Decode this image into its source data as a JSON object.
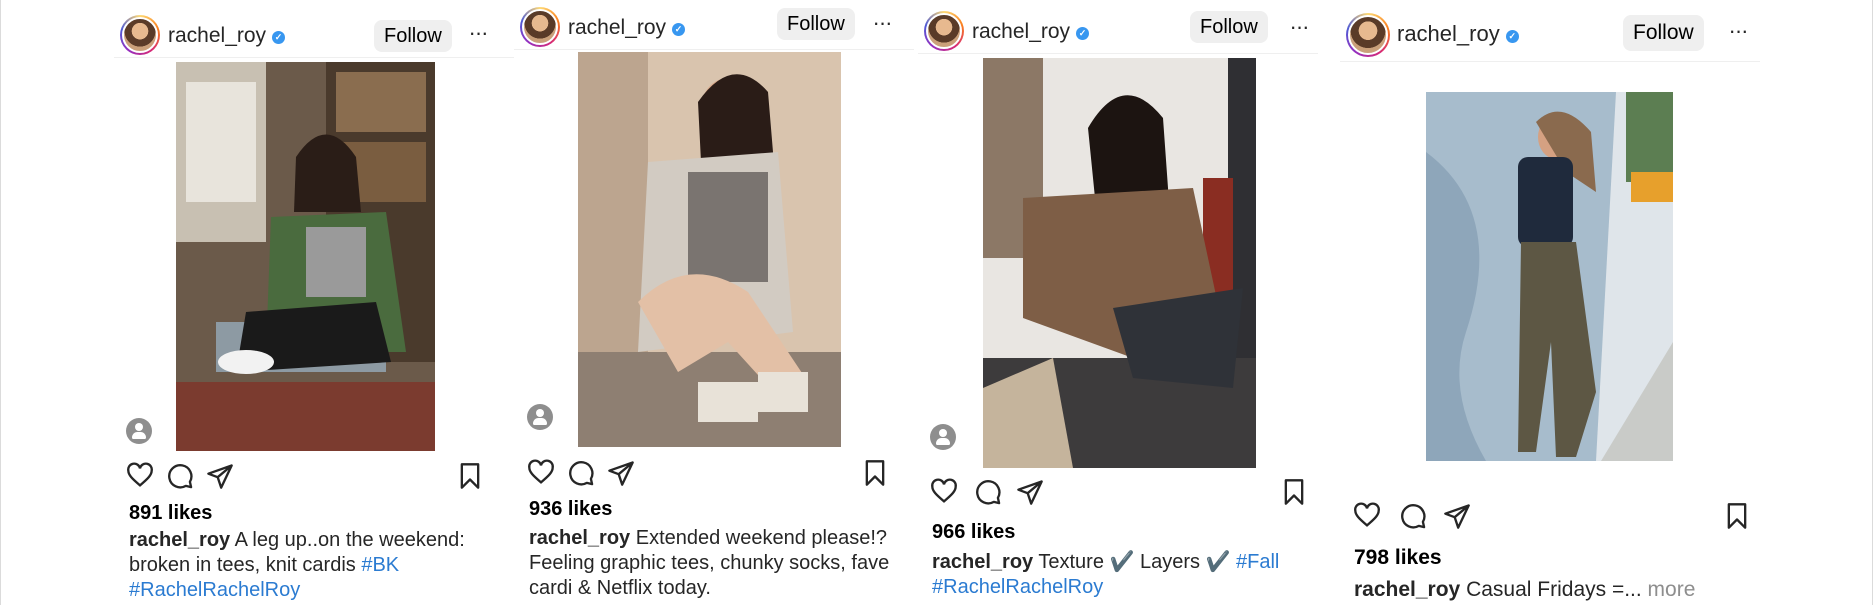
{
  "colors": {
    "accent": "#3897f0",
    "hashtag": "#2b7bd1",
    "follow_bg": "#efefef"
  },
  "icons": [
    "verified-badge-icon",
    "more-options-icon",
    "heart-icon",
    "comment-icon",
    "share-icon",
    "bookmark-icon",
    "tagged-person-icon"
  ],
  "posts": [
    {
      "username": "rachel_roy",
      "follow_label": "Follow",
      "more_label": "···",
      "likes": "891 likes",
      "caption_user": "rachel_roy",
      "caption_text": " A leg up..on the weekend: broken in tees, knit cardis ",
      "hashtags": [
        "#BK",
        "#RachelRachelRoy"
      ]
    },
    {
      "username": "rachel_roy",
      "follow_label": "Follow",
      "more_label": "···",
      "likes": "936 likes",
      "caption_user": "rachel_roy",
      "caption_text": " Extended weekend please!? Feeling graphic tees, chunky socks, fave cardi & Netflix today.",
      "hashtags": []
    },
    {
      "username": "rachel_roy",
      "follow_label": "Follow",
      "more_label": "···",
      "likes": "966 likes",
      "caption_user": "rachel_roy",
      "caption_text": " Texture ✔️ Layers ✔️ ",
      "hashtags": [
        "#Fall",
        "#RachelRachelRoy"
      ]
    },
    {
      "username": "rachel_roy",
      "follow_label": "Follow",
      "more_label": "···",
      "likes": "798 likes",
      "caption_user": "rachel_roy",
      "caption_text": " Casual Fridays =...",
      "more_link": " more",
      "hashtags": []
    }
  ]
}
